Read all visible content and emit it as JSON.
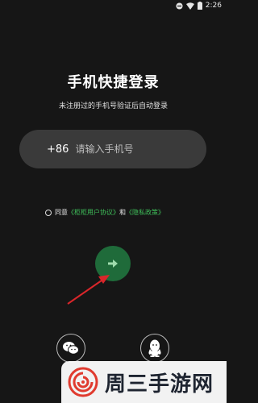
{
  "status_bar": {
    "time": "2:26"
  },
  "login": {
    "title": "手机快捷登录",
    "subtitle": "未注册过的手机号验证后自动登录",
    "country_code": "+86",
    "phone_placeholder": "请输入手机号",
    "agree_prefix": "同意",
    "user_agreement": "《柜柜用户协议》",
    "and": "和",
    "privacy_policy": "《隐私政策》"
  },
  "social": {
    "icons": [
      "wechat-icon",
      "qq-icon"
    ]
  },
  "watermark": {
    "text": "周三手游网"
  },
  "colors": {
    "background": "#161616",
    "input_bg": "#3a3a3a",
    "link": "#3fbf5a",
    "button": "#1f6b3a",
    "annotation_arrow": "#d9262a"
  }
}
